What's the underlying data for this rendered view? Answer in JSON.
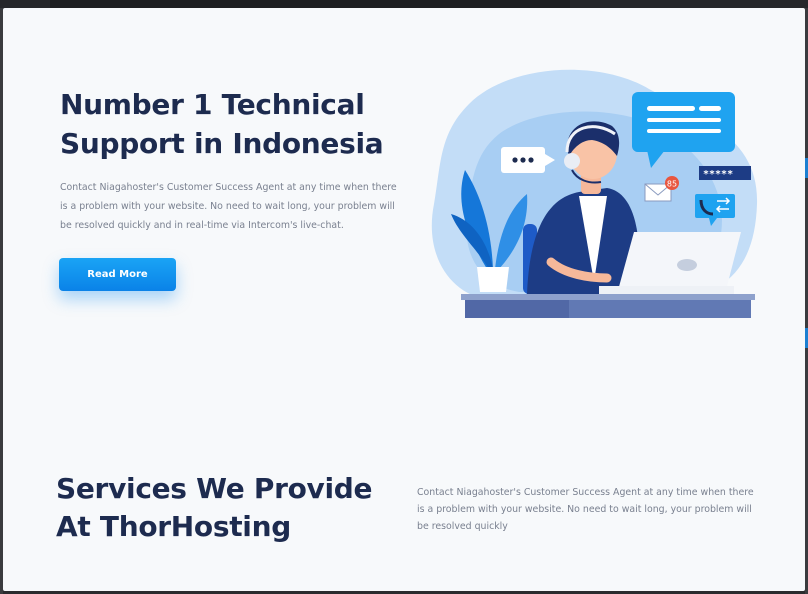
{
  "hero": {
    "title": "Number 1 Technical Support in Indonesia",
    "description": "Contact Niagahoster's Customer Success Agent at any time when there is a problem with your website. No need to wait long, your problem will be resolved quickly and in real-time via Intercom's live-chat.",
    "button_label": "Read More"
  },
  "illustration": {
    "icons": [
      "support-agent-icon",
      "chat-bubble-icon",
      "typing-bubble-icon",
      "envelope-icon",
      "password-field-icon",
      "phone-transfer-icon",
      "laptop-icon",
      "plant-icon"
    ],
    "notification_count": "85",
    "password_mask": "*****"
  },
  "services": {
    "title": "Services We Provide At ThorHosting",
    "description": "Contact Niagahoster's Customer Success Agent at any time when there is a problem with your website. No need to wait long, your problem will be resolved quickly"
  },
  "colors": {
    "heading": "#1d2b4f",
    "body_text": "#7a8190",
    "accent": "#0a82e8",
    "background": "#f7f9fb"
  }
}
